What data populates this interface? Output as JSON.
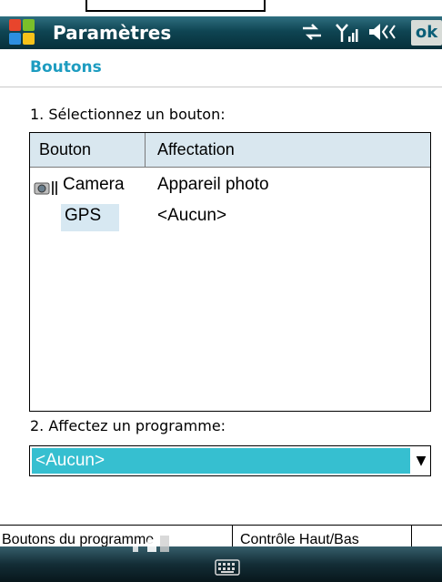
{
  "window": {
    "title": "Paramètres",
    "ok_label": "ok"
  },
  "status_icons": [
    "connectivity-icon",
    "signal-icon",
    "volume-icon"
  ],
  "section": {
    "title": "Boutons"
  },
  "step1": {
    "label": "1. Sélectionnez un bouton:"
  },
  "list": {
    "columns": [
      "Bouton",
      "Affectation"
    ],
    "rows": [
      {
        "button": "Camera",
        "assignment": "Appareil photo",
        "icon": "camera-icon"
      },
      {
        "button": "GPS",
        "assignment": "<Aucun>",
        "selected": true
      }
    ]
  },
  "step2": {
    "label": "2. Affectez un programme:"
  },
  "program_select": {
    "value": "<Aucun>"
  },
  "tabs": [
    {
      "label": "Boutons du programme"
    },
    {
      "label": "Contrôle Haut/Bas"
    }
  ],
  "colors": {
    "accent": "#1d9cc0",
    "selection": "#36bfd0",
    "header_bg": "#d9e7ef"
  }
}
